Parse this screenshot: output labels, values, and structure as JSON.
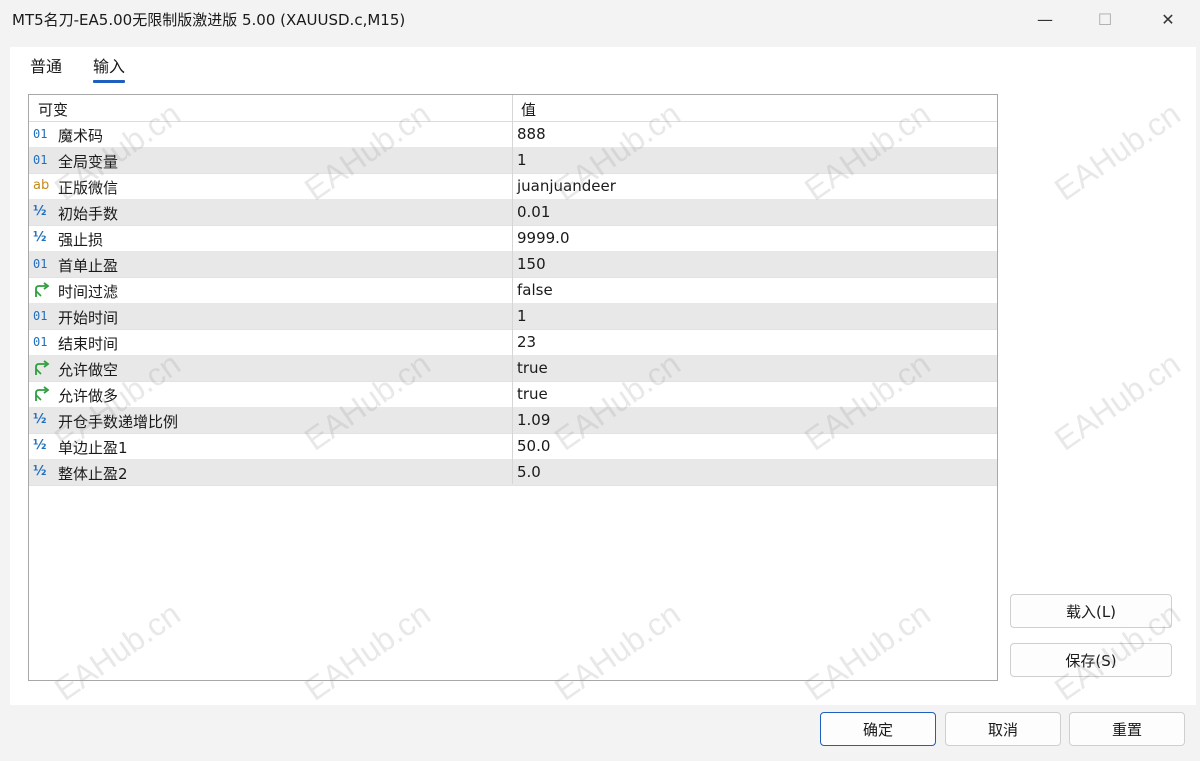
{
  "window": {
    "title": "MT5名刀-EA5.00无限制版激进版 5.00 (XAUUSD.c,M15)",
    "minimize_glyph": "—",
    "maximize_glyph": "☐",
    "close_glyph": "✕"
  },
  "tabs": [
    {
      "label": "普通",
      "active": false
    },
    {
      "label": "输入",
      "active": true
    }
  ],
  "table": {
    "col_name": "可变",
    "col_value": "值",
    "rows": [
      {
        "icon": "int",
        "icon_text": "01",
        "name": "魔术码",
        "value": "888"
      },
      {
        "icon": "int",
        "icon_text": "01",
        "name": "全局变量",
        "value": "1"
      },
      {
        "icon": "string",
        "icon_text": "ab",
        "name": "正版微信",
        "value": "juanjuandeer"
      },
      {
        "icon": "double",
        "icon_text": "½",
        "name": "初始手数",
        "value": "0.01"
      },
      {
        "icon": "double",
        "icon_text": "½",
        "name": "强止损",
        "value": "9999.0"
      },
      {
        "icon": "int",
        "icon_text": "01",
        "name": "首单止盈",
        "value": "150"
      },
      {
        "icon": "bool",
        "icon_text": "",
        "name": "时间过滤",
        "value": "false"
      },
      {
        "icon": "int",
        "icon_text": "01",
        "name": "开始时间",
        "value": "1"
      },
      {
        "icon": "int",
        "icon_text": "01",
        "name": "结束时间",
        "value": "23"
      },
      {
        "icon": "bool",
        "icon_text": "",
        "name": "允许做空",
        "value": "true"
      },
      {
        "icon": "bool",
        "icon_text": "",
        "name": "允许做多",
        "value": "true"
      },
      {
        "icon": "double",
        "icon_text": "½",
        "name": "开仓手数递增比例",
        "value": "1.09"
      },
      {
        "icon": "double",
        "icon_text": "½",
        "name": "单边止盈1",
        "value": "50.0"
      },
      {
        "icon": "double",
        "icon_text": "½",
        "name": "整体止盈2",
        "value": "5.0"
      }
    ]
  },
  "side_buttons": {
    "load": "载入(L)",
    "save": "保存(S)"
  },
  "footer_buttons": {
    "ok": "确定",
    "cancel": "取消",
    "reset": "重置"
  },
  "watermark": "EAHub.cn",
  "colors": {
    "accent": "#1f5fbf",
    "int_icon": "#1f6fbf",
    "string_icon": "#c48a1d",
    "bool_icon": "#2e9e3e"
  }
}
